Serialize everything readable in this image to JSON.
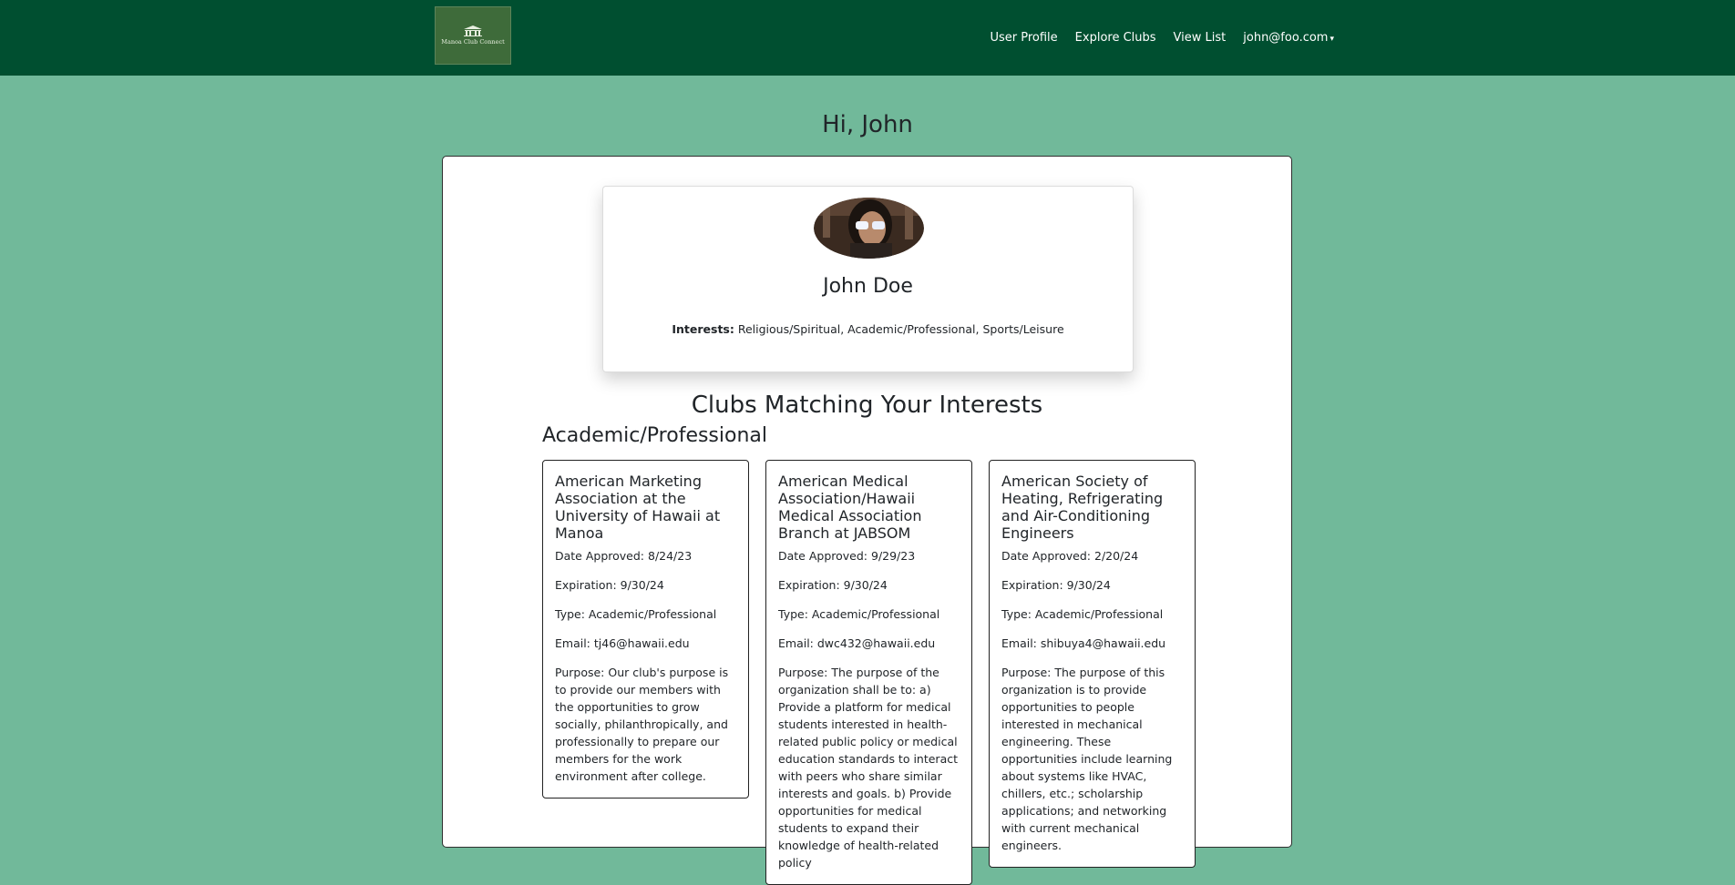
{
  "navbar": {
    "logo_text": "Manoa Club Connect",
    "links": [
      "User Profile",
      "Explore Clubs",
      "View List"
    ],
    "user_menu": "john@foo.com",
    "colors": {
      "background": "#004f30",
      "link": "#ffffff"
    }
  },
  "page": {
    "greeting": "Hi, John",
    "background": "#71b99a"
  },
  "profile": {
    "name": "John Doe",
    "interests_label": "Interests:",
    "interests": "Religious/Spiritual, Academic/Professional, Sports/Leisure",
    "avatar_icon": "user-photo"
  },
  "clubs_section": {
    "title": "Clubs Matching Your Interests",
    "category": "Academic/Professional",
    "clubs": [
      {
        "name": "American Marketing Association at the University of Hawaii at Manoa",
        "date_approved": "Date Approved: 8/24/23",
        "expiration": "Expiration: 9/30/24",
        "type": "Type: Academic/Professional",
        "email": "Email: tj46@hawaii.edu",
        "purpose": "Purpose: Our club's purpose is to provide our members with the opportunities to grow socially, philanthropically, and professionally to prepare our members for the work environment after college."
      },
      {
        "name": "American Medical Association/Hawaii Medical Association Branch at JABSOM",
        "date_approved": "Date Approved: 9/29/23",
        "expiration": "Expiration: 9/30/24",
        "type": "Type: Academic/Professional",
        "email": "Email: dwc432@hawaii.edu",
        "purpose": "Purpose: The purpose of the organization shall be to: a) Provide a platform for medical students interested in health-related public policy or medical education standards to interact with peers who share similar interests and goals. b) Provide opportunities for medical students to expand their knowledge of health-related policy"
      },
      {
        "name": "American Society of Heating, Refrigerating and Air-Conditioning Engineers",
        "date_approved": "Date Approved: 2/20/24",
        "expiration": "Expiration: 9/30/24",
        "type": "Type: Academic/Professional",
        "email": "Email: shibuya4@hawaii.edu",
        "purpose": "Purpose: The purpose of this organization is to provide opportunities to people interested in mechanical engineering. These opportunities include learning about systems like HVAC, chillers, etc.; scholarship applications; and networking with current mechanical engineers."
      }
    ]
  }
}
